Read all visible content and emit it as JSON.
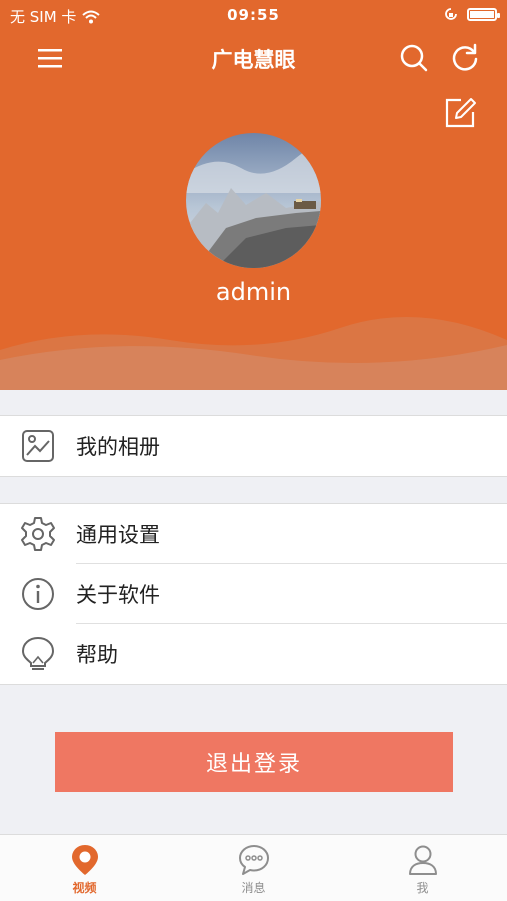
{
  "status_bar": {
    "carrier": "无 SIM 卡",
    "time": "09:55"
  },
  "nav": {
    "title": "广电慧眼"
  },
  "profile": {
    "username": "admin"
  },
  "menu": {
    "group1": [
      {
        "label": "我的相册",
        "icon": "album-icon"
      }
    ],
    "group2": [
      {
        "label": "通用设置",
        "icon": "gear-icon"
      },
      {
        "label": "关于软件",
        "icon": "info-icon"
      },
      {
        "label": "帮助",
        "icon": "bulb-icon"
      }
    ]
  },
  "logout": {
    "label": "退出登录"
  },
  "tabs": [
    {
      "label": "视频",
      "icon": "location-pin-icon",
      "active": true
    },
    {
      "label": "消息",
      "icon": "chat-bubble-icon",
      "active": false
    },
    {
      "label": "我",
      "icon": "person-icon",
      "active": false
    }
  ],
  "colors": {
    "accent": "#e2682d",
    "logout": "#ef7762",
    "background": "#eff0f4"
  }
}
